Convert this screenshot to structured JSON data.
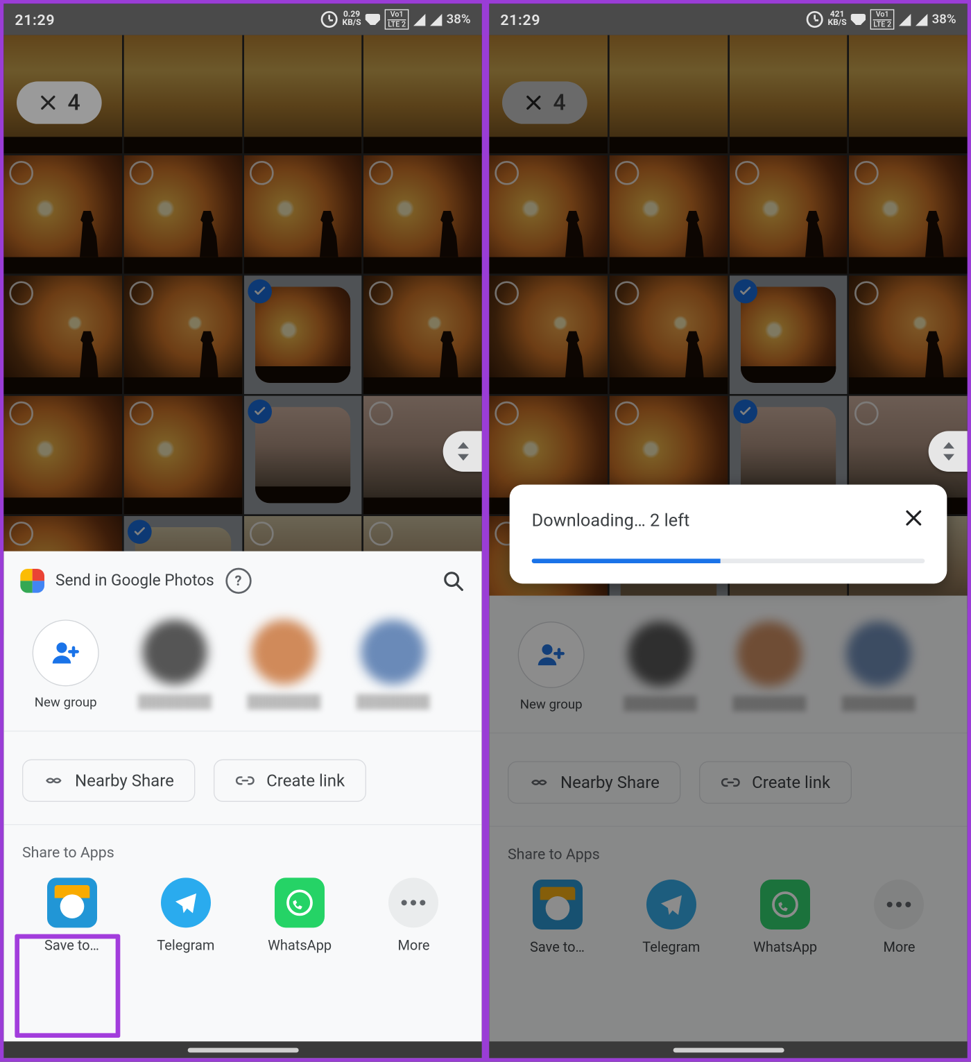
{
  "statusbar": {
    "time": "21:29",
    "speed_a_top": "0.29",
    "speed_a_bottom": "KB/S",
    "speed_b_top": "421",
    "speed_b_bottom": "KB/S",
    "lte_top": "Vo1",
    "lte_bottom": "LTE 2",
    "battery": "38%"
  },
  "selection": {
    "count": "4"
  },
  "share": {
    "title": "Send in Google Photos",
    "new_group": "New group",
    "nearby": "Nearby Share",
    "create_link": "Create link",
    "apps_title": "Share to Apps",
    "apps": {
      "save": "Save to…",
      "telegram": "Telegram",
      "whatsapp": "WhatsApp",
      "more": "More"
    }
  },
  "download": {
    "message": "Downloading… 2 left",
    "progress_pct": 48
  },
  "grid": {
    "rows": [
      [
        {
          "sel": false,
          "cls": "sunset1"
        },
        {
          "sel": false,
          "cls": "sunset1"
        },
        {
          "sel": false,
          "cls": "sunset1"
        },
        {
          "sel": false,
          "cls": "sunset1"
        }
      ],
      [
        {
          "sel": false,
          "cls": "sunset2",
          "person": true
        },
        {
          "sel": false,
          "cls": "sunset2",
          "person": true
        },
        {
          "sel": false,
          "cls": "sunset2",
          "person": true
        },
        {
          "sel": false,
          "cls": "sunset2",
          "person": true
        }
      ],
      [
        {
          "sel": false,
          "cls": "sunset3",
          "person": true
        },
        {
          "sel": false,
          "cls": "sunset3",
          "person": true
        },
        {
          "sel": true,
          "cls": "sunset2"
        },
        {
          "sel": false,
          "cls": "sunset3",
          "person": true
        }
      ],
      [
        {
          "sel": false,
          "cls": "sunset2"
        },
        {
          "sel": false,
          "cls": "sunset2"
        },
        {
          "sel": true,
          "cls": "sunset4"
        },
        {
          "sel": false,
          "cls": "sunset4"
        }
      ],
      [
        {
          "sel": false,
          "cls": "sunset2"
        },
        {
          "sel": true,
          "cls": "sunset5"
        },
        {
          "sel": false,
          "cls": "sunset5"
        },
        {
          "sel": false,
          "cls": "sunset5"
        }
      ]
    ]
  }
}
